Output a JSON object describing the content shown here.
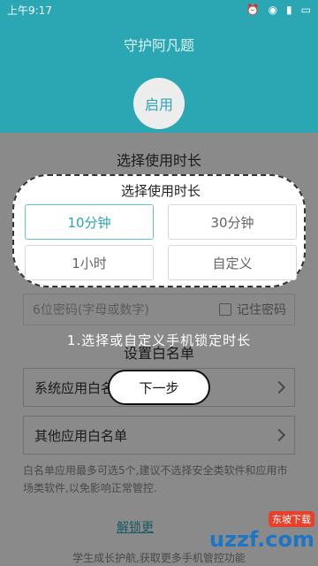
{
  "status_bar": {
    "time": "上午9:17",
    "battery_icon": "battery-icon"
  },
  "header": {
    "title": "守护阿凡题",
    "enable_label": "启用"
  },
  "main": {
    "duration_title": "选择使用时长",
    "password_placeholder": "6位密码(字母或数字)",
    "remember_label": "记住密码",
    "whitelist_title": "设置白名单",
    "system_whitelist": "系统应用白名单",
    "other_whitelist": "其他应用白名单",
    "note": "白名单应用最多可选5个,建议不选择安全类软件和应用市场类软件,以免影响正常管控.",
    "unlock_link": "解锁更",
    "bottom_note": "学生成长护航,获取更多手机管控功能"
  },
  "guide": {
    "title": "选择使用时长",
    "options": [
      "10分钟",
      "30分钟",
      "1小时",
      "自定义"
    ],
    "selected_index": 0,
    "hint": "1.选择或自定义手机锁定时长",
    "next_label": "下一步"
  },
  "watermark": {
    "text": "uzzf.com",
    "tag": "东坡下载"
  }
}
